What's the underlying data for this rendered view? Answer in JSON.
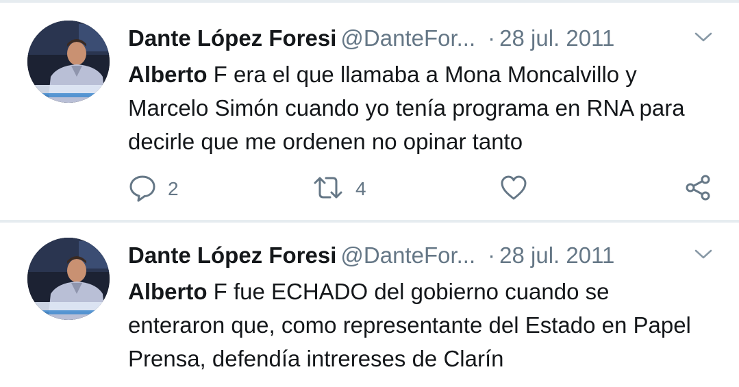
{
  "tweets": [
    {
      "author_name": "Dante López Foresi",
      "handle": "@DanteFor...",
      "separator": "·",
      "date": "28 jul. 2011",
      "text_bold": "Alberto",
      "text_rest": " F era el que llamaba a Mona Moncalvillo y Marcelo Simón cuando yo tenía programa en RNA para decirle que me ordenen no opinar tanto",
      "reply_count": "2",
      "retweet_count": "4",
      "avatar_caption": "Dante López Foresi"
    },
    {
      "author_name": "Dante López Foresi",
      "handle": "@DanteFor...",
      "separator": "·",
      "date": "28 jul. 2011",
      "text_bold": "Alberto",
      "text_rest": " F fue ECHADO del gobierno cuando se enteraron que, como representante del Estado en Papel Prensa, defendía intrereses de Clarín",
      "avatar_caption": "Dante López Foresi"
    }
  ],
  "icons": {
    "menu": "chevron-down-icon",
    "reply": "reply-icon",
    "retweet": "retweet-icon",
    "like": "heart-icon",
    "share": "share-icon"
  },
  "colors": {
    "text": "#14171a",
    "secondary": "#657786",
    "divider": "#e6ecf0",
    "chevron": "#8899a6"
  }
}
